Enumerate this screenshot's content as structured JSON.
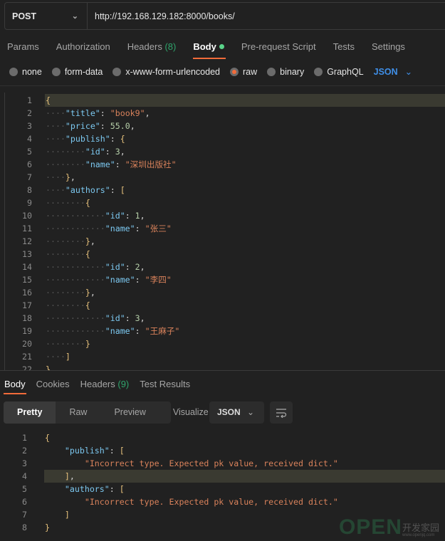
{
  "request": {
    "method": "POST",
    "url": "http://192.168.129.182:8000/books/"
  },
  "tabs": [
    {
      "label": "Params"
    },
    {
      "label": "Authorization"
    },
    {
      "label": "Headers",
      "count": "(8)"
    },
    {
      "label": "Body",
      "active": true
    },
    {
      "label": "Pre-request Script"
    },
    {
      "label": "Tests"
    },
    {
      "label": "Settings"
    }
  ],
  "body_types": [
    {
      "label": "none"
    },
    {
      "label": "form-data"
    },
    {
      "label": "x-www-form-urlencoded"
    },
    {
      "label": "raw",
      "selected": true
    },
    {
      "label": "binary"
    },
    {
      "label": "GraphQL"
    }
  ],
  "raw_format": "JSON",
  "request_body": [
    {
      "indent": 0,
      "tokens": [
        [
          "b",
          "{"
        ]
      ],
      "hl": true
    },
    {
      "indent": 1,
      "tokens": [
        [
          "k",
          "\"title\""
        ],
        [
          "p",
          ": "
        ],
        [
          "s",
          "\"book9\""
        ],
        [
          "p",
          ","
        ]
      ]
    },
    {
      "indent": 1,
      "tokens": [
        [
          "k",
          "\"price\""
        ],
        [
          "p",
          ": "
        ],
        [
          "n",
          "55.0"
        ],
        [
          "p",
          ","
        ]
      ]
    },
    {
      "indent": 1,
      "tokens": [
        [
          "k",
          "\"publish\""
        ],
        [
          "p",
          ": "
        ],
        [
          "b",
          "{"
        ]
      ]
    },
    {
      "indent": 2,
      "tokens": [
        [
          "k",
          "\"id\""
        ],
        [
          "p",
          ": "
        ],
        [
          "n",
          "3"
        ],
        [
          "p",
          ","
        ]
      ]
    },
    {
      "indent": 2,
      "tokens": [
        [
          "k",
          "\"name\""
        ],
        [
          "p",
          ": "
        ],
        [
          "s",
          "\"深圳出版社\""
        ]
      ]
    },
    {
      "indent": 1,
      "tokens": [
        [
          "b",
          "}"
        ],
        [
          "p",
          ","
        ]
      ]
    },
    {
      "indent": 1,
      "tokens": [
        [
          "k",
          "\"authors\""
        ],
        [
          "p",
          ": "
        ],
        [
          "b",
          "["
        ]
      ]
    },
    {
      "indent": 2,
      "tokens": [
        [
          "b",
          "{"
        ]
      ]
    },
    {
      "indent": 3,
      "tokens": [
        [
          "k",
          "\"id\""
        ],
        [
          "p",
          ": "
        ],
        [
          "n",
          "1"
        ],
        [
          "p",
          ","
        ]
      ]
    },
    {
      "indent": 3,
      "tokens": [
        [
          "k",
          "\"name\""
        ],
        [
          "p",
          ": "
        ],
        [
          "s",
          "\"张三\""
        ]
      ]
    },
    {
      "indent": 2,
      "tokens": [
        [
          "b",
          "}"
        ],
        [
          "p",
          ","
        ]
      ]
    },
    {
      "indent": 2,
      "tokens": [
        [
          "b",
          "{"
        ]
      ]
    },
    {
      "indent": 3,
      "tokens": [
        [
          "k",
          "\"id\""
        ],
        [
          "p",
          ": "
        ],
        [
          "n",
          "2"
        ],
        [
          "p",
          ","
        ]
      ]
    },
    {
      "indent": 3,
      "tokens": [
        [
          "k",
          "\"name\""
        ],
        [
          "p",
          ": "
        ],
        [
          "s",
          "\"李四\""
        ]
      ]
    },
    {
      "indent": 2,
      "tokens": [
        [
          "b",
          "}"
        ],
        [
          "p",
          ","
        ]
      ]
    },
    {
      "indent": 2,
      "tokens": [
        [
          "b",
          "{"
        ]
      ]
    },
    {
      "indent": 3,
      "tokens": [
        [
          "k",
          "\"id\""
        ],
        [
          "p",
          ": "
        ],
        [
          "n",
          "3"
        ],
        [
          "p",
          ","
        ]
      ]
    },
    {
      "indent": 3,
      "tokens": [
        [
          "k",
          "\"name\""
        ],
        [
          "p",
          ": "
        ],
        [
          "s",
          "\"王麻子\""
        ]
      ]
    },
    {
      "indent": 2,
      "tokens": [
        [
          "b",
          "}"
        ]
      ]
    },
    {
      "indent": 1,
      "tokens": [
        [
          "b",
          "]"
        ]
      ]
    },
    {
      "indent": 0,
      "tokens": [
        [
          "b",
          "}"
        ]
      ]
    }
  ],
  "response_tabs": [
    {
      "label": "Body",
      "active": true
    },
    {
      "label": "Cookies"
    },
    {
      "label": "Headers",
      "count": "(9)"
    },
    {
      "label": "Test Results"
    }
  ],
  "view_modes": [
    {
      "label": "Pretty",
      "active": true
    },
    {
      "label": "Raw"
    },
    {
      "label": "Preview"
    },
    {
      "label": "Visualize"
    }
  ],
  "response_format": "JSON",
  "response_body": [
    {
      "indent": 0,
      "tokens": [
        [
          "b",
          "{"
        ]
      ]
    },
    {
      "indent": 1,
      "tokens": [
        [
          "k",
          "\"publish\""
        ],
        [
          "p",
          ": "
        ],
        [
          "b",
          "["
        ]
      ]
    },
    {
      "indent": 2,
      "tokens": [
        [
          "s",
          "\"Incorrect type. Expected pk value, received dict.\""
        ]
      ]
    },
    {
      "indent": 1,
      "tokens": [
        [
          "b",
          "]"
        ],
        [
          "p",
          ","
        ]
      ],
      "hl": true
    },
    {
      "indent": 1,
      "tokens": [
        [
          "k",
          "\"authors\""
        ],
        [
          "p",
          ": "
        ],
        [
          "b",
          "["
        ]
      ]
    },
    {
      "indent": 2,
      "tokens": [
        [
          "s",
          "\"Incorrect type. Expected pk value, received dict.\""
        ]
      ]
    },
    {
      "indent": 1,
      "tokens": [
        [
          "b",
          "]"
        ]
      ]
    },
    {
      "indent": 0,
      "tokens": [
        [
          "b",
          "}"
        ]
      ]
    }
  ],
  "watermark": {
    "big": "OPEN",
    "cn": "开发家园",
    "url": "www.openjq.com"
  }
}
